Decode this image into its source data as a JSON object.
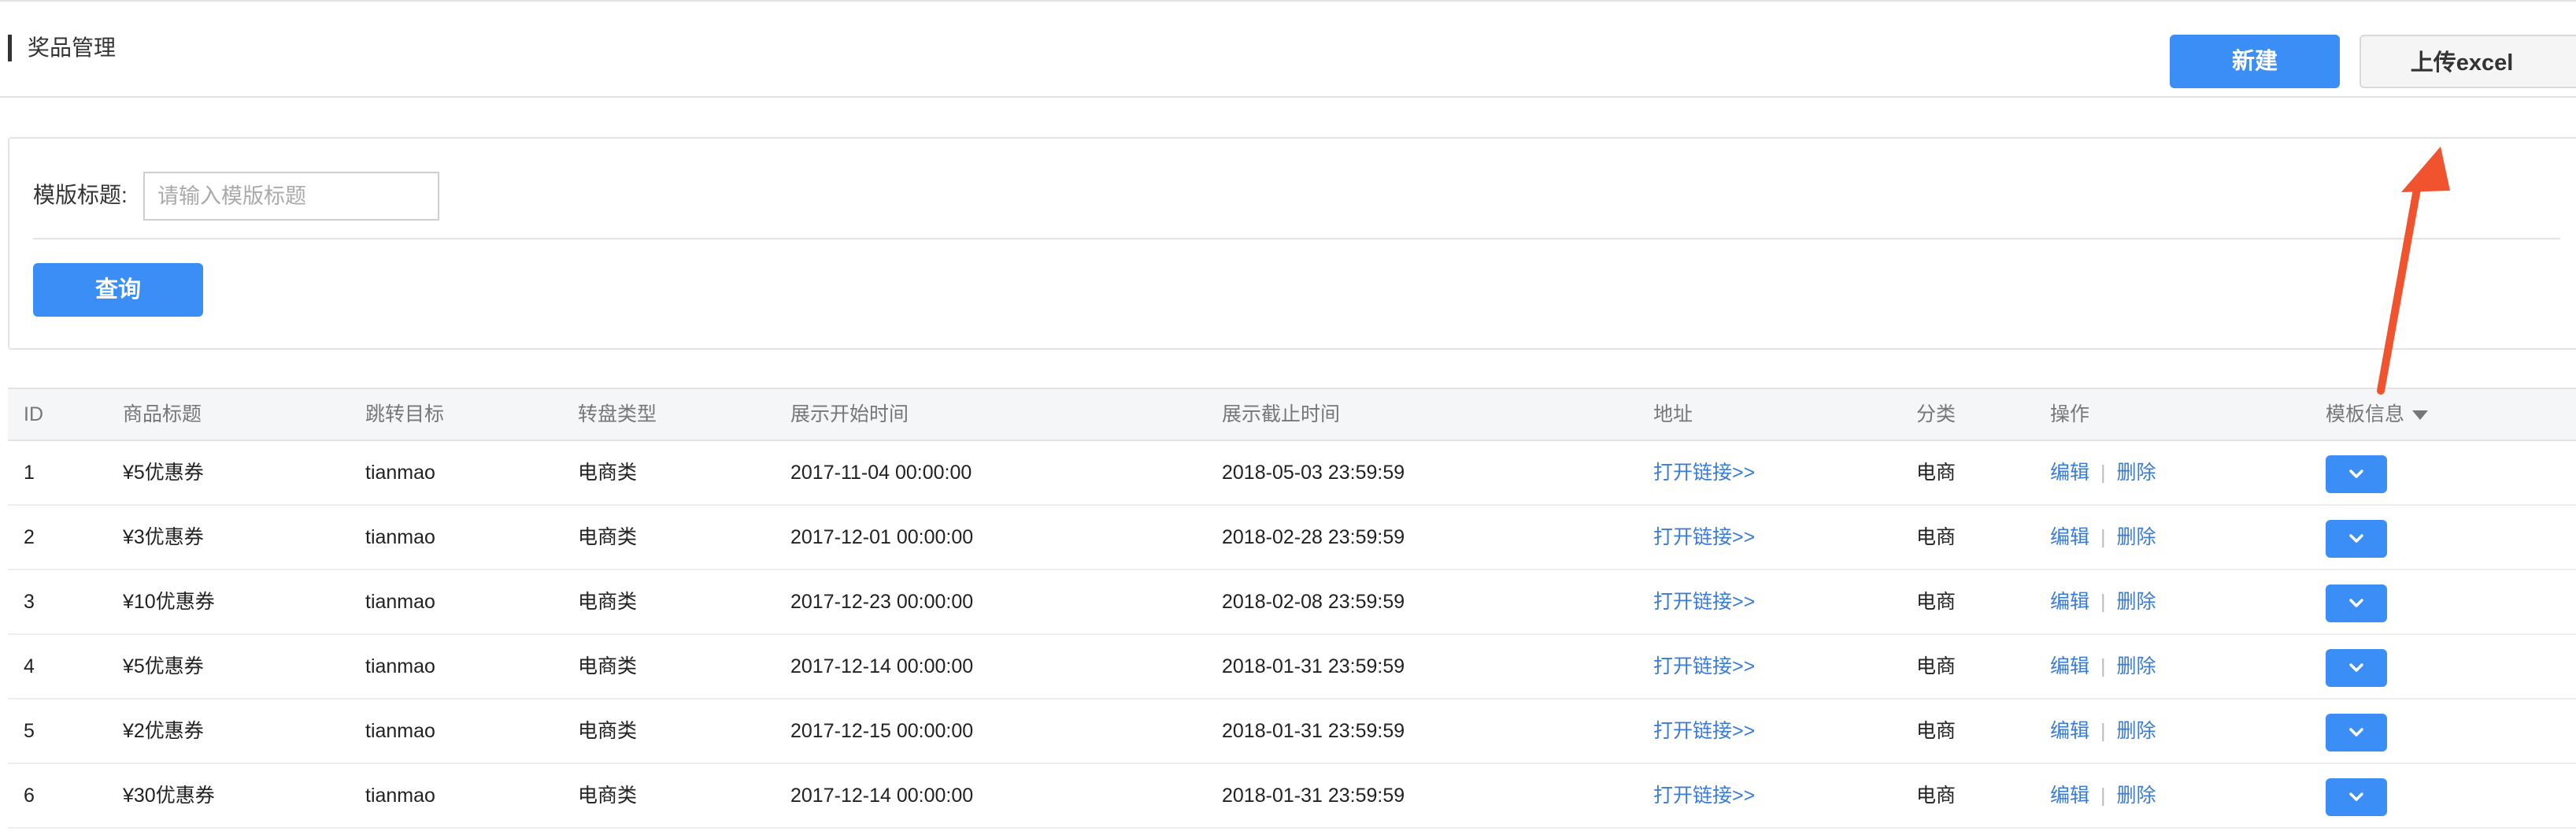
{
  "header": {
    "title": "奖品管理",
    "new_label": "新建",
    "upload_label": "上传excel"
  },
  "search": {
    "label": "模版标题:",
    "placeholder": "请输入模版标题",
    "value": "",
    "query_label": "查询"
  },
  "table": {
    "columns": {
      "id": "ID",
      "title": "商品标题",
      "target": "跳转目标",
      "type": "转盘类型",
      "start": "展示开始时间",
      "end": "展示截止时间",
      "address": "地址",
      "category": "分类",
      "operations": "操作",
      "template_info": "模板信息"
    },
    "rows": [
      {
        "id": "1",
        "title": "¥5优惠券",
        "target": "tianmao",
        "type": "电商类",
        "start": "2017-11-04 00:00:00",
        "end": "2018-05-03 23:59:59",
        "address": "打开链接>>",
        "category": "电商",
        "edit": "编辑",
        "delete": "删除"
      },
      {
        "id": "2",
        "title": "¥3优惠券",
        "target": "tianmao",
        "type": "电商类",
        "start": "2017-12-01 00:00:00",
        "end": "2018-02-28 23:59:59",
        "address": "打开链接>>",
        "category": "电商",
        "edit": "编辑",
        "delete": "删除"
      },
      {
        "id": "3",
        "title": "¥10优惠券",
        "target": "tianmao",
        "type": "电商类",
        "start": "2017-12-23 00:00:00",
        "end": "2018-02-08 23:59:59",
        "address": "打开链接>>",
        "category": "电商",
        "edit": "编辑",
        "delete": "删除"
      },
      {
        "id": "4",
        "title": "¥5优惠券",
        "target": "tianmao",
        "type": "电商类",
        "start": "2017-12-14 00:00:00",
        "end": "2018-01-31 23:59:59",
        "address": "打开链接>>",
        "category": "电商",
        "edit": "编辑",
        "delete": "删除"
      },
      {
        "id": "5",
        "title": "¥2优惠券",
        "target": "tianmao",
        "type": "电商类",
        "start": "2017-12-15 00:00:00",
        "end": "2018-01-31 23:59:59",
        "address": "打开链接>>",
        "category": "电商",
        "edit": "编辑",
        "delete": "删除"
      },
      {
        "id": "6",
        "title": "¥30优惠券",
        "target": "tianmao",
        "type": "电商类",
        "start": "2017-12-14 00:00:00",
        "end": "2018-01-31 23:59:59",
        "address": "打开链接>>",
        "category": "电商",
        "edit": "编辑",
        "delete": "删除"
      }
    ]
  },
  "icons": {
    "expand": "chevron-down-icon",
    "sort": "caret-down-icon"
  },
  "colors": {
    "primary": "#3a8ef6",
    "link": "#3a7bd5",
    "annotation": "#f0532d"
  }
}
